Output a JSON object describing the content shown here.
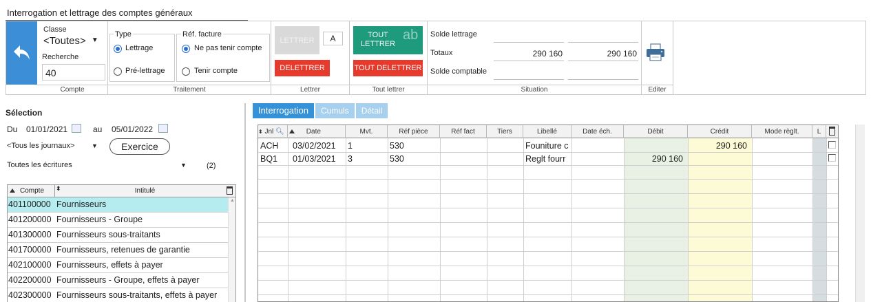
{
  "window": {
    "title": "Interrogation et lettrage des comptes généraux"
  },
  "ribbon": {
    "compte": {
      "classe_label": "Classe",
      "classe_value": "<Toutes>",
      "recherche_label": "Recherche",
      "recherche_value": "40",
      "footer": "Compte"
    },
    "traitement": {
      "type_label": "Type",
      "type_options": [
        "Lettrage",
        "Pré-lettrage"
      ],
      "ref_label": "Réf. facture",
      "ref_options": [
        "Ne pas tenir compte",
        "Tenir compte"
      ],
      "footer": "Traitement"
    },
    "lettrer": {
      "lettrer_label": "LETTRER",
      "letter_value": "A",
      "delettrer_label": "DELETTRER",
      "footer": "Lettrer"
    },
    "tout_lettrer": {
      "tout_lettrer_label_1": "TOUT",
      "tout_lettrer_label_2": "LETTRER",
      "ab_label": "ab",
      "tout_delettrer_label": "TOUT DELETTRER",
      "footer": "Tout lettrer"
    },
    "situation": {
      "solde_lettrage_label": "Solde lettrage",
      "totaux_label": "Totaux",
      "total_debit": "290 160",
      "total_credit": "290 160",
      "solde_comptable_label": "Solde comptable",
      "footer": "Situation"
    },
    "editer": {
      "footer": "Editer"
    }
  },
  "selection": {
    "heading": "Sélection",
    "du_label": "Du",
    "date_from": "01/01/2021",
    "au_label": "au",
    "date_to": "05/01/2022",
    "journaux_value": "<Tous les journaux>",
    "exercice_label": "Exercice",
    "ecritures_value": "Toutes les écritures",
    "count": "(2)"
  },
  "accounts": {
    "headers": {
      "compte": "Compte",
      "intitule": "Intitulé"
    },
    "rows": [
      {
        "compte": "401100000",
        "intitule": "Fournisseurs"
      },
      {
        "compte": "401200000",
        "intitule": "Fournisseurs - Groupe"
      },
      {
        "compte": "401300000",
        "intitule": "Fournisseurs sous-traitants"
      },
      {
        "compte": "401700000",
        "intitule": "Fournisseurs, retenues de garantie"
      },
      {
        "compte": "402100000",
        "intitule": "Fournisseurs, effets à payer"
      },
      {
        "compte": "402200000",
        "intitule": "Fournisseurs - Groupe, effets à payer"
      },
      {
        "compte": "402300000",
        "intitule": "Fournisseurs sous-traitants, effets à payer"
      }
    ]
  },
  "tabs": [
    "Interrogation",
    "Cumuls",
    "Détail"
  ],
  "grid": {
    "headers": [
      "Jnl",
      "Date",
      "Mvt.",
      "Réf pièce",
      "Réf fact",
      "Tiers",
      "Libellé",
      "Date éch.",
      "Débit",
      "Crédit",
      "Mode règlt.",
      "L"
    ],
    "rows": [
      {
        "jnl": "ACH",
        "date": "03/02/2021",
        "mvt": "1",
        "ref_piece": "530",
        "ref_fact": "",
        "tiers": "",
        "libelle": "Founiture c",
        "date_ech": "",
        "debit": "",
        "credit": "290 160",
        "mode": ""
      },
      {
        "jnl": "BQ1",
        "date": "01/03/2021",
        "mvt": "3",
        "ref_piece": "530",
        "ref_fact": "",
        "tiers": "",
        "libelle": "Reglt fourr",
        "date_ech": "",
        "debit": "290 160",
        "credit": "",
        "mode": ""
      }
    ]
  },
  "colors": {
    "accent_blue": "#3c8fd6",
    "red": "#e53a2c",
    "green": "#1e9a7d",
    "selected_row": "#b4ecf0",
    "debit_column": "#e8f1e3",
    "credit_column": "#fdfbd6"
  }
}
